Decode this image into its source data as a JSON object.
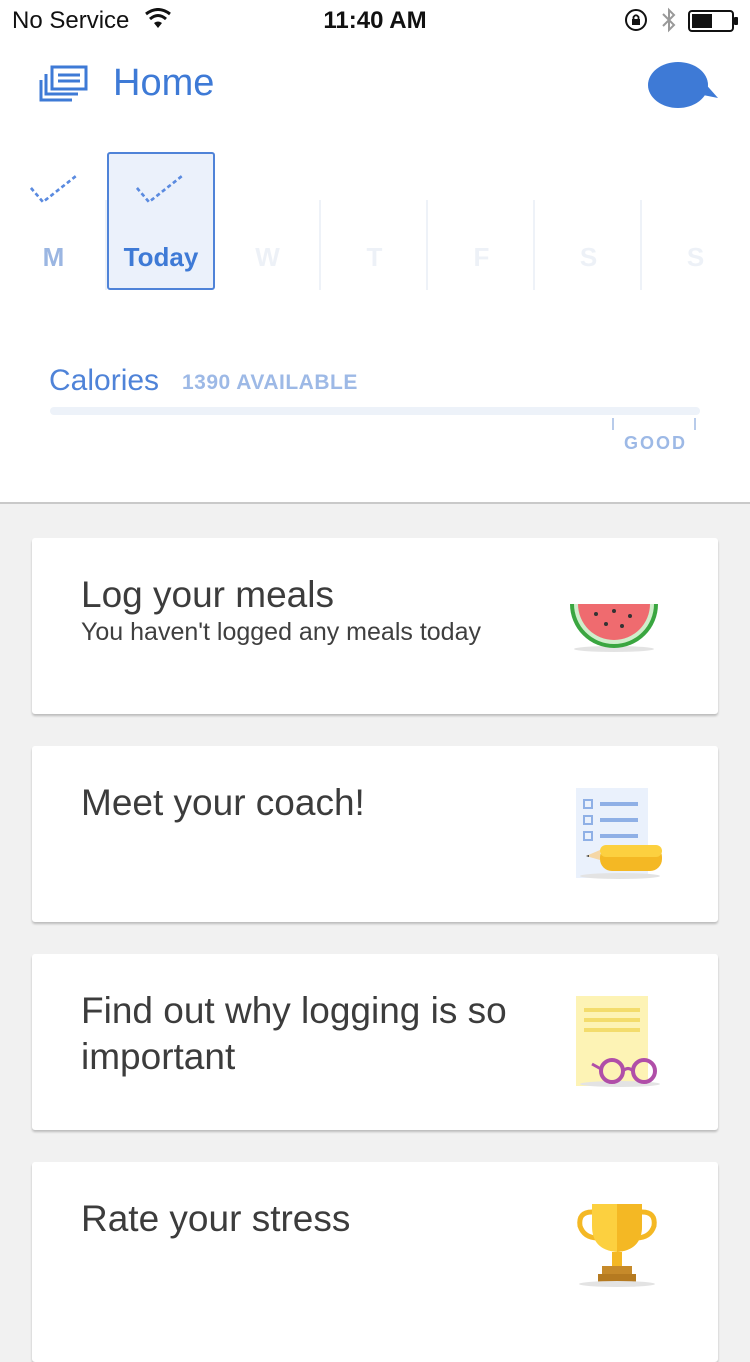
{
  "status_bar": {
    "carrier": "No Service",
    "time": "11:40 AM"
  },
  "header": {
    "title": "Home",
    "menu_icon": "layers-icon",
    "chat_icon": "chat-bubble-icon"
  },
  "days": [
    {
      "label": "M",
      "checked": true
    },
    {
      "label": "Today",
      "checked": true,
      "selected": true
    },
    {
      "label": "W"
    },
    {
      "label": "T"
    },
    {
      "label": "F"
    },
    {
      "label": "S"
    },
    {
      "label": "S"
    }
  ],
  "calories": {
    "label": "Calories",
    "available": "1390 AVAILABLE",
    "range_label": "GOOD"
  },
  "cards": [
    {
      "title": "Log your meals",
      "subtitle": "You haven't logged any meals today",
      "icon": "watermelon-icon"
    },
    {
      "title": "Meet your coach!",
      "icon": "checklist-pencil-icon"
    },
    {
      "title": "Find out why logging is so important",
      "icon": "notes-glasses-icon"
    },
    {
      "title": "Rate your stress",
      "icon": "trophy-icon"
    }
  ],
  "colors": {
    "accent": "#3e7ad6",
    "background": "#f1f1f1"
  }
}
